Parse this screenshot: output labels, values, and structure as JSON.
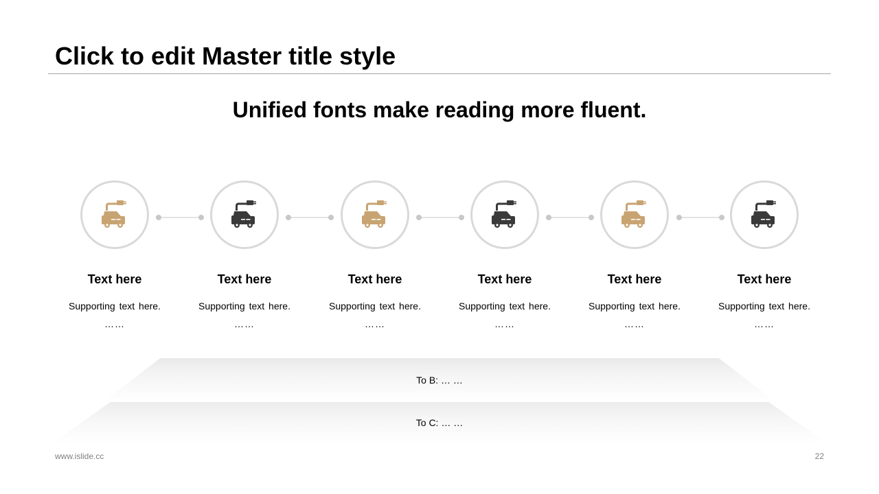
{
  "slide": {
    "title": "Click to edit Master title style",
    "subtitle": "Unified fonts make reading more fluent."
  },
  "colors": {
    "accent": "#c8a472",
    "dark": "#3a3a3a",
    "circle_border": "#d9d9d9"
  },
  "steps": [
    {
      "icon": "electric-car-icon",
      "icon_color": "accent",
      "title": "Text here",
      "desc": "Supporting text here.",
      "dots": "……"
    },
    {
      "icon": "electric-car-icon",
      "icon_color": "dark",
      "title": "Text here",
      "desc": "Supporting text here.",
      "dots": "……"
    },
    {
      "icon": "electric-car-icon",
      "icon_color": "accent",
      "title": "Text here",
      "desc": "Supporting text here.",
      "dots": "……"
    },
    {
      "icon": "electric-car-icon",
      "icon_color": "dark",
      "title": "Text here",
      "desc": "Supporting text here.",
      "dots": "……"
    },
    {
      "icon": "electric-car-icon",
      "icon_color": "accent",
      "title": "Text here",
      "desc": "Supporting text here.",
      "dots": "……"
    },
    {
      "icon": "electric-car-icon",
      "icon_color": "dark",
      "title": "Text here",
      "desc": "Supporting text here.",
      "dots": "……"
    }
  ],
  "bands": [
    {
      "label": "To B: … …"
    },
    {
      "label": "To C: … …"
    }
  ],
  "footer": {
    "website": "www.islide.cc",
    "page_number": "22"
  }
}
